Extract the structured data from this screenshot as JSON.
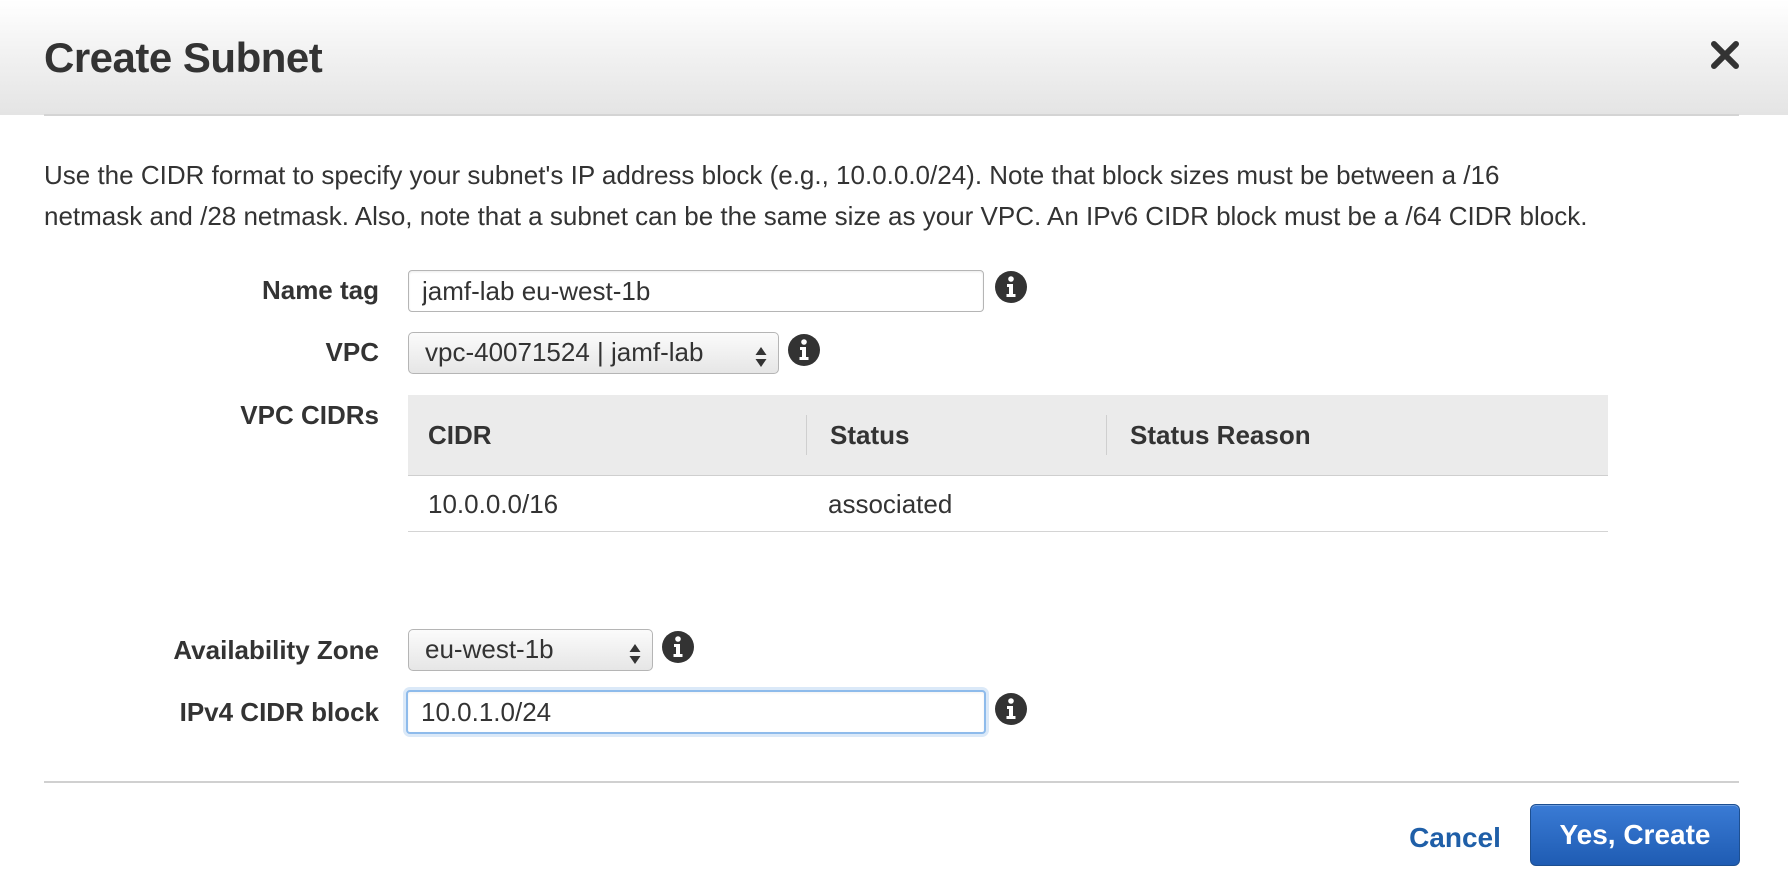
{
  "dialog": {
    "title": "Create Subnet",
    "description_line1": "Use the CIDR format to specify your subnet's IP address block (e.g., 10.0.0.0/24). Note that block sizes must be between a /16",
    "description_line2": "netmask and /28 netmask. Also, note that a subnet can be the same size as your VPC. An IPv6 CIDR block must be a /64 CIDR block."
  },
  "form": {
    "name_tag": {
      "label": "Name tag",
      "value": "jamf-lab eu-west-1b"
    },
    "vpc": {
      "label": "VPC",
      "selected": "vpc-40071524 | jamf-lab"
    },
    "vpc_cidrs": {
      "label": "VPC CIDRs",
      "columns": [
        "CIDR",
        "Status",
        "Status Reason"
      ],
      "rows": [
        {
          "cidr": "10.0.0.0/16",
          "status": "associated",
          "reason": ""
        }
      ]
    },
    "availability_zone": {
      "label": "Availability Zone",
      "selected": "eu-west-1b"
    },
    "ipv4_cidr": {
      "label": "IPv4 CIDR block",
      "value": "10.0.1.0/24"
    }
  },
  "footer": {
    "cancel_label": "Cancel",
    "create_label": "Yes, Create"
  },
  "colors": {
    "primary_button": "#2a6cc6",
    "link": "#1f5fa8",
    "focus_ring": "#8ebbeb",
    "icon": "#333333"
  },
  "icons": {
    "close": "close-icon",
    "info": "info-icon",
    "select_arrows": "select-arrows-icon"
  }
}
